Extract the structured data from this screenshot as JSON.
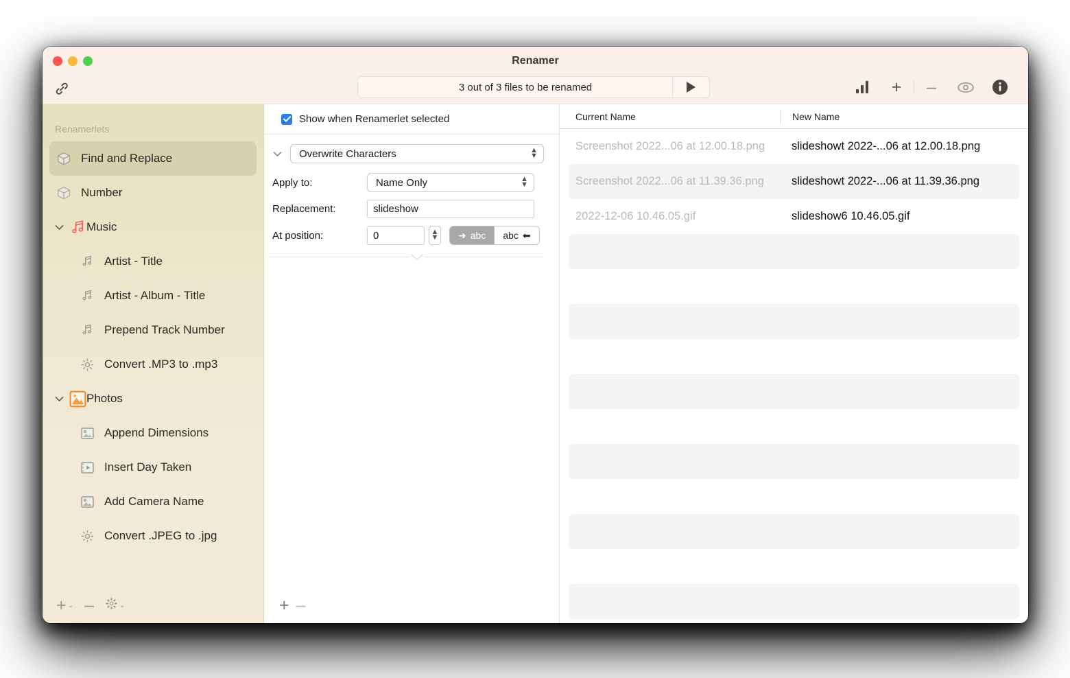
{
  "window": {
    "title": "Renamer",
    "traffic_lights": [
      "close",
      "minimize",
      "zoom"
    ]
  },
  "toolbar": {
    "link_icon": "link-icon",
    "status_text": "3 out of 3 files to be renamed",
    "run_icon": "play-icon",
    "items": [
      {
        "name": "chart-icon",
        "label": ""
      },
      {
        "name": "add-icon",
        "label": "+"
      },
      {
        "name": "remove-icon",
        "label": "–"
      },
      {
        "name": "eye-icon",
        "label": ""
      },
      {
        "name": "info-icon",
        "label": ""
      }
    ]
  },
  "sidebar": {
    "header": "Renamerlets",
    "items": [
      {
        "label": "Find and Replace",
        "icon": "cube-icon",
        "level": 0,
        "selected": true,
        "disclosure": ""
      },
      {
        "label": "Number",
        "icon": "cube-icon",
        "level": 0,
        "selected": false,
        "disclosure": ""
      },
      {
        "label": "Music",
        "icon": "music-note-icon",
        "level": 0,
        "selected": false,
        "disclosure": "chevron-down-icon",
        "group": true
      },
      {
        "label": "Artist - Title",
        "icon": "music-note-icon",
        "level": 1,
        "selected": false,
        "disclosure": ""
      },
      {
        "label": "Artist - Album - Title",
        "icon": "music-note-icon",
        "level": 1,
        "selected": false,
        "disclosure": ""
      },
      {
        "label": "Prepend Track Number",
        "icon": "music-note-icon",
        "level": 1,
        "selected": false,
        "disclosure": ""
      },
      {
        "label": "Convert .MP3 to .mp3",
        "icon": "gear-icon",
        "level": 1,
        "selected": false,
        "disclosure": ""
      },
      {
        "label": "Photos",
        "icon": "photo-icon",
        "level": 0,
        "selected": false,
        "disclosure": "chevron-down-icon",
        "group": true
      },
      {
        "label": "Append Dimensions",
        "icon": "photo-icon",
        "level": 1,
        "selected": false,
        "disclosure": ""
      },
      {
        "label": "Insert Day Taken",
        "icon": "film-icon",
        "level": 1,
        "selected": false,
        "disclosure": ""
      },
      {
        "label": "Add Camera Name",
        "icon": "photo-icon",
        "level": 1,
        "selected": false,
        "disclosure": ""
      },
      {
        "label": "Convert .JPEG to .jpg",
        "icon": "gear-icon",
        "level": 1,
        "selected": false,
        "disclosure": ""
      }
    ],
    "footer": {
      "add_label": "+",
      "add_chevron": "⌄",
      "remove_label": "–",
      "settings_icon": "gear-icon",
      "settings_chevron": "⌄"
    }
  },
  "inspector": {
    "show_when_selected_label": "Show when Renamerlet selected",
    "show_when_selected_checked": true,
    "action_type": "Overwrite Characters",
    "fields": [
      {
        "label": "Apply to:",
        "value": "Name Only",
        "kind": "popup"
      },
      {
        "label": "Replacement:",
        "value": "slideshow",
        "kind": "text"
      },
      {
        "label": "At position:",
        "value": "0",
        "kind": "number"
      }
    ],
    "direction_segments": [
      {
        "label": "abc",
        "arrow": "➜",
        "arrow_side": "left",
        "selected": true
      },
      {
        "label": "abc",
        "arrow": "⬅",
        "arrow_side": "right",
        "selected": false
      }
    ],
    "footer": {
      "add_label": "+",
      "remove_label": "–"
    }
  },
  "filelist": {
    "columns": [
      "Current Name",
      "New Name"
    ],
    "rows": [
      {
        "current": "Screenshot 2022...06 at 12.00.18.png",
        "new": "slideshowt 2022-...06 at 12.00.18.png"
      },
      {
        "current": "Screenshot 2022...06 at 11.39.36.png",
        "new": "slideshowt 2022-...06 at 11.39.36.png"
      },
      {
        "current": "2022-12-06 10.46.05.gif",
        "new": "slideshow6 10.46.05.gif"
      },
      {
        "current": "",
        "new": ""
      },
      {
        "current": "",
        "new": ""
      },
      {
        "current": "",
        "new": ""
      },
      {
        "current": "",
        "new": ""
      },
      {
        "current": "",
        "new": ""
      },
      {
        "current": "",
        "new": ""
      },
      {
        "current": "",
        "new": ""
      },
      {
        "current": "",
        "new": ""
      },
      {
        "current": "",
        "new": ""
      },
      {
        "current": "",
        "new": ""
      },
      {
        "current": "",
        "new": ""
      }
    ]
  },
  "colors": {
    "titlebar": "#faf0e9",
    "sidebar_top": "#e5e1bd",
    "sidebar_bottom": "#f3e9d9",
    "selected_row": "#d6d2ae",
    "accent_checkbox": "#2a7ef0",
    "photos_accent": "#f08c2a",
    "music_accent": "#f05a5a",
    "stripe": "#f4f4f4"
  }
}
